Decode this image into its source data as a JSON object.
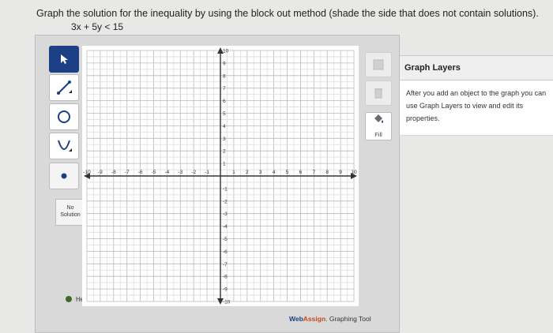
{
  "question": {
    "text": "Graph the solution for the inequality by using the block out method (shade the side that does not contain solutions).",
    "inequality": "3x + 5y < 15"
  },
  "toolbar": {
    "tools": [
      {
        "name": "pointer-tool",
        "icon": "arrow-pointer-icon",
        "active": true
      },
      {
        "name": "line-tool",
        "icon": "line-icon"
      },
      {
        "name": "circle-tool",
        "icon": "circle-icon"
      },
      {
        "name": "parabola-tool",
        "icon": "parabola-icon"
      },
      {
        "name": "point-tool",
        "icon": "point-icon"
      }
    ],
    "no_solution": "No Solution",
    "help": "Help"
  },
  "graph": {
    "x_ticks": [
      "-10",
      "-9",
      "-8",
      "-7",
      "-6",
      "-5",
      "-4",
      "-3",
      "-2",
      "-1",
      "1",
      "2",
      "3",
      "4",
      "5",
      "6",
      "7",
      "8",
      "9",
      "10"
    ],
    "y_ticks": [
      "10",
      "9",
      "8",
      "7",
      "6",
      "5",
      "4",
      "3",
      "2",
      "1",
      "-1",
      "-2",
      "-3",
      "-4",
      "-5",
      "-6",
      "-7",
      "-8",
      "-9",
      "-10"
    ],
    "x_range": [
      -10,
      10
    ],
    "y_range": [
      -10,
      10
    ],
    "grid": true
  },
  "right_controls": {
    "fill_label": "Fill",
    "icons": [
      "palette-icon",
      "trash-icon",
      "paint-bucket-icon"
    ]
  },
  "brand": {
    "web": "Web",
    "assign": "Assign",
    "rest": ". Graphing Tool"
  },
  "layers": {
    "title": "Graph Layers",
    "description": "After you add an object to the graph you can use Graph Layers to view and edit its properties."
  }
}
